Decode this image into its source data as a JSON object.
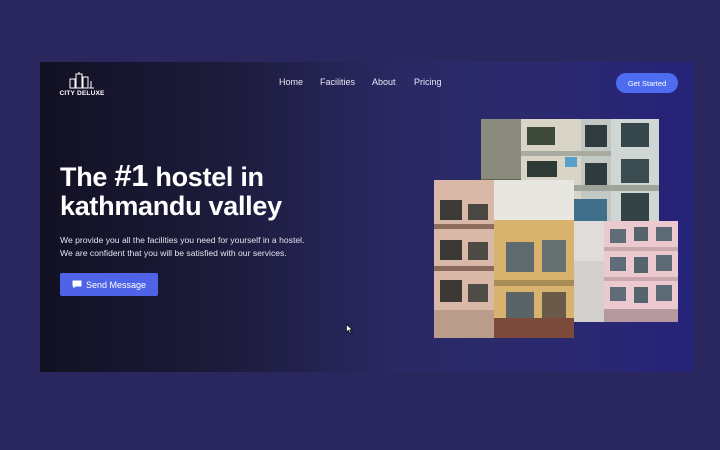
{
  "brand": {
    "name": "CITY DELUXE",
    "logo_icon": "city-skyline-icon"
  },
  "nav": {
    "items": [
      "Home",
      "Facilities",
      "About",
      "Pricing"
    ],
    "cta_label": "Get Started"
  },
  "hero": {
    "title_prefix": "The ",
    "title_highlight": "#1",
    "title_line1_rest": " hostel in",
    "title_line2": "kathmandu valley",
    "description_line1": "We provide you all the facilities you need for yourself in a hostel.",
    "description_line2": "We are confident that you will be satisfied with our services.",
    "button_label": "Send Message",
    "button_icon": "chat-icon"
  },
  "colors": {
    "page_background": "#29275e",
    "accent": "#4e6cf0",
    "text": "#ffffff"
  }
}
